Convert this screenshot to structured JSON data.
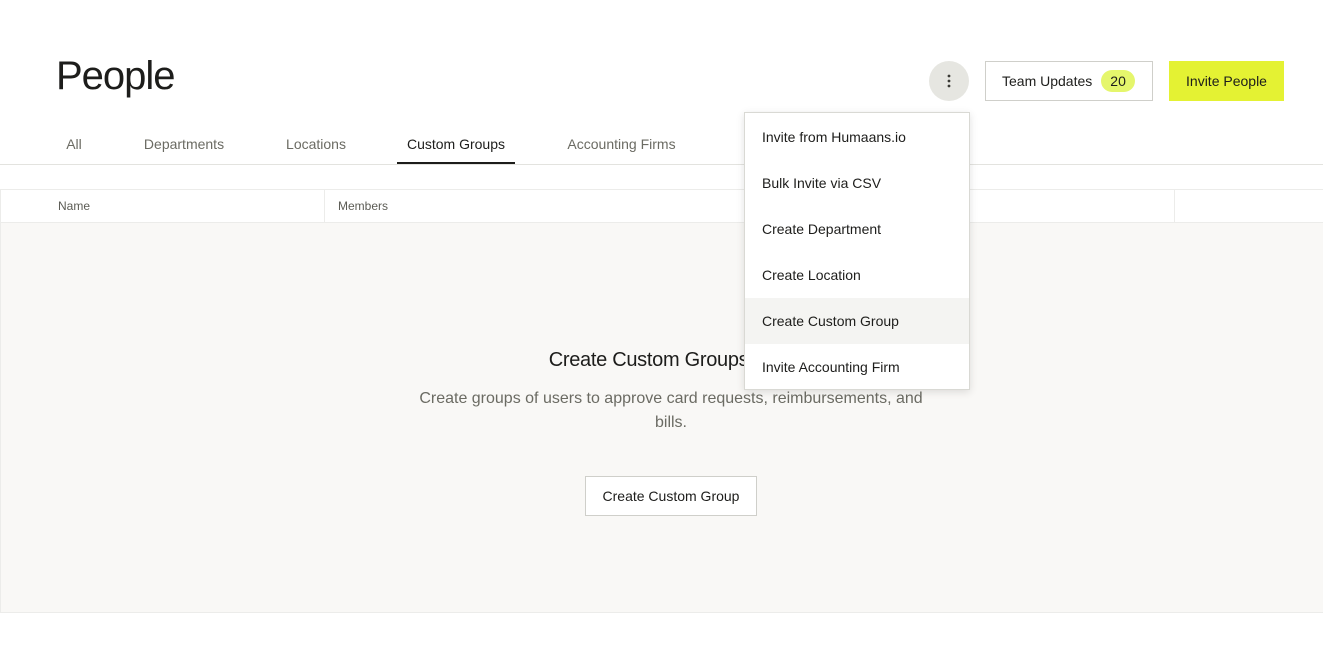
{
  "header": {
    "title": "People",
    "more_icon": "more-vertical-icon",
    "team_updates_label": "Team Updates",
    "team_updates_count": "20",
    "invite_label": "Invite People",
    "colors": {
      "accent": "#e4f233",
      "badge": "#e5f66c"
    }
  },
  "tabs": [
    {
      "label": "All"
    },
    {
      "label": "Departments"
    },
    {
      "label": "Locations"
    },
    {
      "label": "Custom Groups",
      "active": true
    },
    {
      "label": "Accounting Firms"
    }
  ],
  "table": {
    "columns": [
      "Name",
      "Members"
    ]
  },
  "empty_state": {
    "title": "Create Custom Groups for A",
    "description": "Create groups of users to approve card requests, reimbursements, and bills.",
    "button_label": "Create Custom Group"
  },
  "menu": {
    "items": [
      {
        "label": "Invite from Humaans.io"
      },
      {
        "label": "Bulk Invite via CSV"
      },
      {
        "label": "Create Department"
      },
      {
        "label": "Create Location"
      },
      {
        "label": "Create Custom Group",
        "hovered": true
      },
      {
        "label": "Invite Accounting Firm"
      }
    ]
  }
}
